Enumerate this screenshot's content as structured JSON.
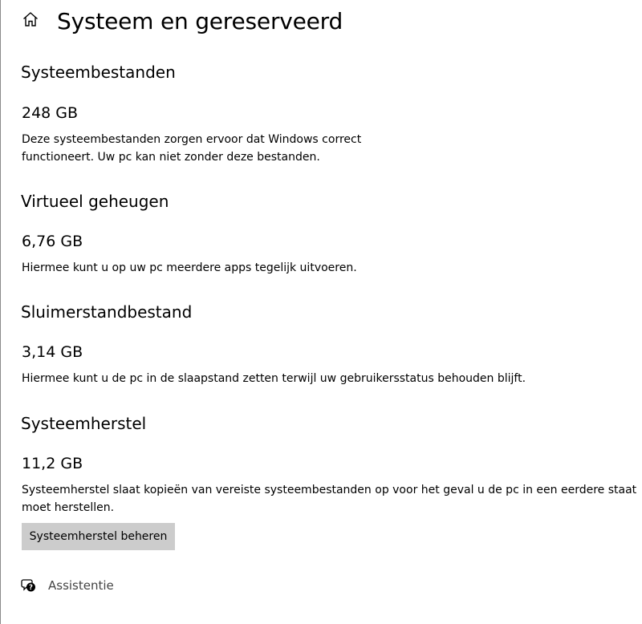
{
  "page": {
    "title": "Systeem en gereserveerd"
  },
  "sections": [
    {
      "title": "Systeembestanden",
      "size": "248 GB",
      "description_lines": [
        "Deze systeembestanden zorgen ervoor dat Windows correct",
        "functioneert. Uw pc kan niet zonder deze bestanden."
      ]
    },
    {
      "title": "Virtueel geheugen",
      "size": "6,76 GB",
      "description_lines": [
        "Hiermee kunt u op uw pc meerdere apps tegelijk uitvoeren."
      ]
    },
    {
      "title": "Sluimerstandbestand",
      "size": "3,14 GB",
      "description_lines": [
        "Hiermee kunt u de pc in de slaapstand zetten terwijl uw gebruikersstatus behouden blijft."
      ]
    },
    {
      "title": "Systeemherstel",
      "size": "11,2 GB",
      "description_lines": [
        "Systeemherstel slaat kopieën van vereiste systeembestanden op voor het geval u de pc in een eerdere staat",
        "moet herstellen."
      ]
    }
  ],
  "actions": {
    "manage_restore_label": "Systeemherstel beheren"
  },
  "help": {
    "label": "Assistentie"
  },
  "icons": {
    "home": "home-icon",
    "help": "help-chat-icon"
  },
  "colors": {
    "button_bg": "#cccccc",
    "help_text": "#444444"
  }
}
